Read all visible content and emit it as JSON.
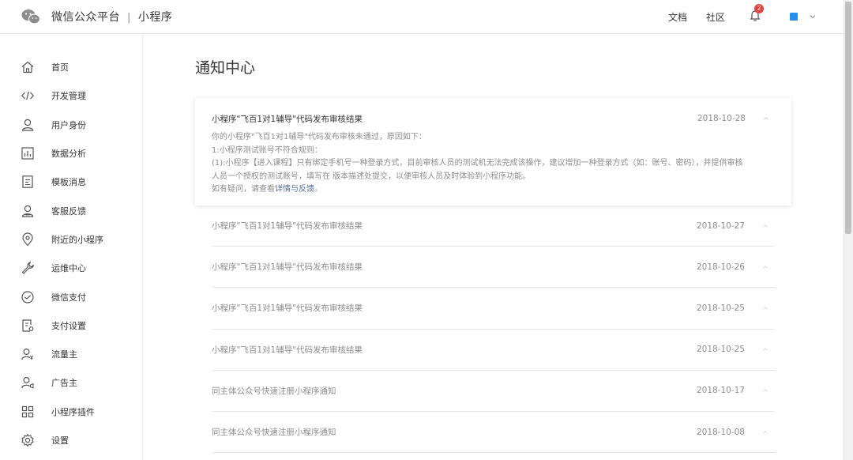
{
  "header": {
    "brand": "微信公众平台",
    "separator": "|",
    "product": "小程序",
    "links": [
      "文档",
      "社区"
    ],
    "notification_count": "2"
  },
  "sidebar": {
    "items": [
      {
        "label": "首页",
        "icon": "home-icon"
      },
      {
        "label": "开发管理",
        "icon": "code-icon"
      },
      {
        "label": "用户身份",
        "icon": "user-icon"
      },
      {
        "label": "数据分析",
        "icon": "chart-icon"
      },
      {
        "label": "模板消息",
        "icon": "document-icon"
      },
      {
        "label": "客服反馈",
        "icon": "customer-service-icon"
      },
      {
        "label": "附近的小程序",
        "icon": "location-icon"
      },
      {
        "label": "运维中心",
        "icon": "wrench-icon"
      },
      {
        "label": "微信支付",
        "icon": "wechat-pay-icon"
      },
      {
        "label": "支付设置",
        "icon": "payment-settings-icon"
      },
      {
        "label": "流量主",
        "icon": "traffic-owner-icon"
      },
      {
        "label": "广告主",
        "icon": "advertiser-icon"
      },
      {
        "label": "小程序插件",
        "icon": "plugin-icon"
      },
      {
        "label": "设置",
        "icon": "gear-icon"
      }
    ]
  },
  "main": {
    "title": "通知中心",
    "expanded": {
      "title": "小程序\"飞百1对1辅导\"代码发布审核结果",
      "date": "2018-10-28",
      "body_lines": [
        "你的小程序\"飞百1对1辅导\"代码发布审核未通过，原因如下：",
        "1:小程序测试账号不符合规则：",
        "(1):小程序【进入课程】只有绑定手机号一种登录方式，目前审核人员的测试机无法完成该操作，建议增加一种登录方式（如：账号、密码），并提供审核",
        "人员一个授权的测试账号，填写在 版本描述处提交，以便审核人员及时体验到小程序功能。"
      ],
      "footer_prefix": "如有疑问，请查看",
      "footer_link": "详情与反馈",
      "footer_suffix": "。"
    },
    "notices": [
      {
        "title": "小程序\"飞百1对1辅导\"代码发布审核结果",
        "date": "2018-10-27"
      },
      {
        "title": "小程序\"飞百1对1辅导\"代码发布审核结果",
        "date": "2018-10-26"
      },
      {
        "title": "小程序\"飞百1对1辅导\"代码发布审核结果",
        "date": "2018-10-25"
      },
      {
        "title": "小程序\"飞百1对1辅导\"代码发布审核结果",
        "date": "2018-10-25"
      },
      {
        "title": "同主体公众号快速注册小程序通知",
        "date": "2018-10-17"
      },
      {
        "title": "同主体公众号快速注册小程序通知",
        "date": "2018-10-08"
      }
    ]
  },
  "colors": {
    "accent_link": "#576b95",
    "badge": "#e64340",
    "muted_text": "#8d8d8d"
  }
}
